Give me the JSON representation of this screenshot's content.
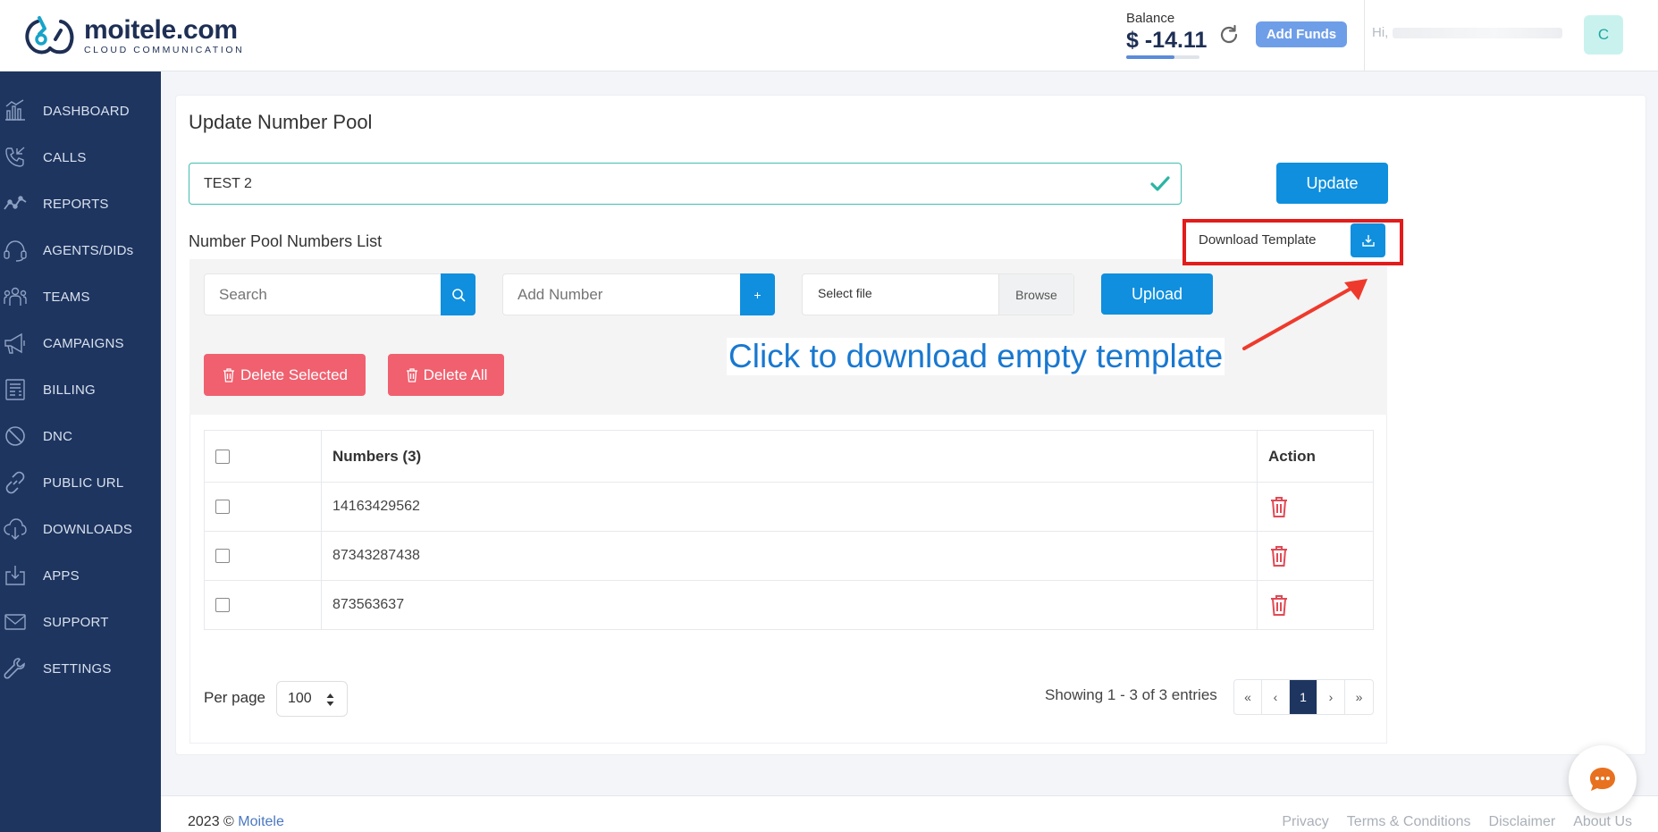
{
  "header": {
    "logo_name": "moitele.com",
    "logo_tagline": "CLOUD COMMUNICATION",
    "balance_label": "Balance",
    "balance_value": "$ -14.11",
    "add_funds_label": "Add Funds",
    "greeting_prefix": "Hi,",
    "avatar_initial": "C"
  },
  "sidebar": {
    "items": [
      {
        "label": "DASHBOARD",
        "icon": "dashboard-icon"
      },
      {
        "label": "CALLS",
        "icon": "phone-icon"
      },
      {
        "label": "REPORTS",
        "icon": "chart-line-icon"
      },
      {
        "label": "AGENTS/DIDs",
        "icon": "headset-icon"
      },
      {
        "label": "TEAMS",
        "icon": "team-icon"
      },
      {
        "label": "CAMPAIGNS",
        "icon": "megaphone-icon"
      },
      {
        "label": "BILLING",
        "icon": "billing-icon"
      },
      {
        "label": "DNC",
        "icon": "ban-icon"
      },
      {
        "label": "PUBLIC URL",
        "icon": "link-icon"
      },
      {
        "label": "DOWNLOADS",
        "icon": "cloud-download-icon"
      },
      {
        "label": "APPS",
        "icon": "apps-download-icon"
      },
      {
        "label": "SUPPORT",
        "icon": "mail-icon"
      },
      {
        "label": "SETTINGS",
        "icon": "wrench-icon"
      }
    ]
  },
  "main": {
    "title": "Update Number Pool",
    "pool_name_value": "TEST 2",
    "update_label": "Update",
    "list_title": "Number Pool Numbers List",
    "download_template_label": "Download Template",
    "search_placeholder": "Search",
    "add_number_placeholder": "Add Number",
    "add_button_label": "+",
    "select_file_label": "Select file",
    "browse_label": "Browse",
    "upload_label": "Upload",
    "delete_selected_label": "Delete Selected",
    "delete_all_label": "Delete All",
    "annotation": "Click to download empty template",
    "table": {
      "headers": [
        "Numbers (3)",
        "Action"
      ],
      "rows": [
        {
          "number": "14163429562"
        },
        {
          "number": "87343287438"
        },
        {
          "number": "873563637"
        }
      ]
    },
    "per_page_label": "Per page",
    "per_page_value": "100",
    "showing_text": "Showing 1 - 3 of 3 entries",
    "pagination": [
      "«",
      "‹",
      "1",
      "›",
      "»"
    ]
  },
  "footer": {
    "year_text": "2023 ©",
    "brand_link": "Moitele",
    "links": [
      "Privacy",
      "Terms & Conditions",
      "Disclaimer",
      "About Us"
    ]
  },
  "colors": {
    "sidebar_bg": "#1e3560",
    "primary": "#0f8fde",
    "danger": "#f0606f",
    "success_border": "#3fbfb0",
    "annotation_box": "#e31b1b"
  }
}
